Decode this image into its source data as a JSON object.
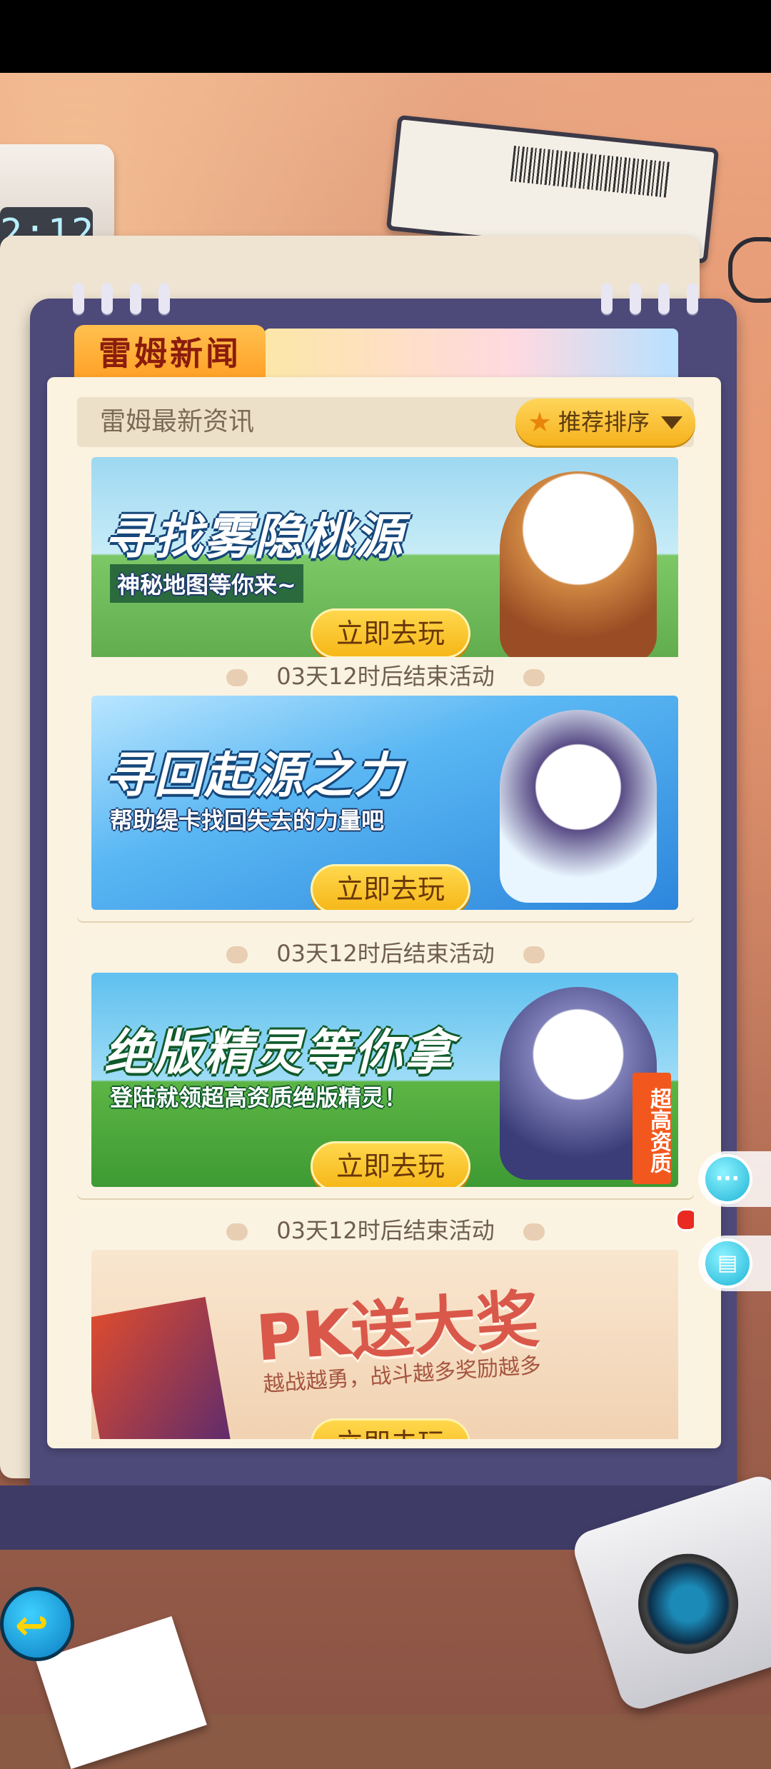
{
  "clock": {
    "time": "2:12"
  },
  "header": {
    "tab_title": "雷姆新闻",
    "section_title": "雷姆最新资讯",
    "sort_label": "推荐排序"
  },
  "cards": [
    {
      "countdown": "",
      "banner_title": "寻找雾隐桃源",
      "banner_subtitle": "神秘地图等你来~",
      "button_label": "立即去玩",
      "colors": {
        "sky": "#9ed8f2",
        "ground": "#6dbd5a"
      }
    },
    {
      "countdown": "03天12时后结束活动",
      "banner_title": "寻回起源之力",
      "banner_subtitle": "帮助缇卡找回失去的力量吧",
      "button_label": "立即去玩",
      "colors": {
        "sky": "#47a7f0",
        "ground": "#2a7bd6"
      }
    },
    {
      "countdown": "03天12时后结束活动",
      "banner_title": "绝版精灵等你拿",
      "banner_subtitle": "登陆就领超高资质绝版精灵！",
      "tag": "超高资质",
      "button_label": "立即去玩",
      "colors": {
        "sky": "#68c4f0",
        "ground": "#52b13e"
      }
    },
    {
      "countdown": "03天12时后结束活动",
      "banner_title": "PK送大奖",
      "banner_subtitle": "越战越勇，战斗越多奖励越多",
      "button_label": "立即去玩",
      "colors": {
        "sky": "#f7dcc0",
        "ground": "#e9b78f"
      }
    }
  ],
  "side_buttons": {
    "chat_icon": "chat-bubble-icon",
    "book_icon": "book-icon"
  },
  "back": {
    "icon": "back-arrow-icon"
  }
}
